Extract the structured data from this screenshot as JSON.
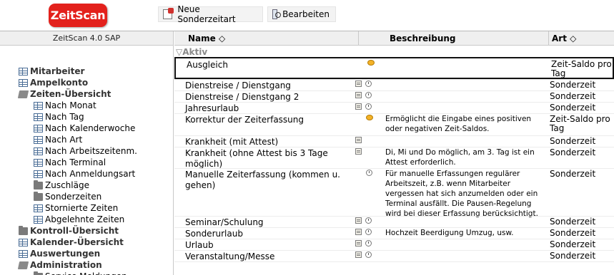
{
  "app": {
    "logo_text": "ZeitScan"
  },
  "toolbar": {
    "new_label": "Neue Sonderzeitart",
    "edit_label": "Bearbeiten"
  },
  "sidebar": {
    "title": "ZeitScan 4.0 SAP",
    "items": [
      {
        "label": "Mitarbeiter",
        "level": "top",
        "icon": "grid-icon"
      },
      {
        "label": "Ampelkonto",
        "level": "top",
        "icon": "grid-icon"
      },
      {
        "label": "Zeiten-Übersicht",
        "level": "top",
        "icon": "folder-open-icon"
      },
      {
        "label": "Nach Monat",
        "level": "child",
        "icon": "grid-icon"
      },
      {
        "label": "Nach Tag",
        "level": "child",
        "icon": "grid-icon"
      },
      {
        "label": "Nach Kalenderwoche",
        "level": "child",
        "icon": "grid-icon"
      },
      {
        "label": "Nach Art",
        "level": "child",
        "icon": "grid-icon"
      },
      {
        "label": "Nach Arbeitszeitenm.",
        "level": "child",
        "icon": "grid-icon"
      },
      {
        "label": "Nach Terminal",
        "level": "child",
        "icon": "grid-icon"
      },
      {
        "label": "Nach Anmeldungsart",
        "level": "child",
        "icon": "grid-icon"
      },
      {
        "label": "Zuschläge",
        "level": "child",
        "icon": "folder-icon"
      },
      {
        "label": "Sonderzeiten",
        "level": "child",
        "icon": "folder-icon"
      },
      {
        "label": "Stornierte Zeiten",
        "level": "child",
        "icon": "grid-icon"
      },
      {
        "label": "Abgelehnte Zeiten",
        "level": "child",
        "icon": "grid-icon"
      },
      {
        "label": "Kontroll-Übersicht",
        "level": "top",
        "icon": "folder-icon"
      },
      {
        "label": "Kalender-Übersicht",
        "level": "top",
        "icon": "grid-icon"
      },
      {
        "label": "Auswertungen",
        "level": "top",
        "icon": "grid-icon"
      },
      {
        "label": "Administration",
        "level": "top",
        "icon": "folder-open-icon"
      },
      {
        "label": "Service Meldungen",
        "level": "child",
        "icon": "folder-icon"
      }
    ]
  },
  "table": {
    "columns": {
      "name": "Name ◇",
      "beschreibung": "Beschreibung",
      "art": "Art ◇"
    },
    "group_label": "▽Aktiv",
    "rows": [
      {
        "name": "Ausgleich",
        "icons": [
          "coin-icon"
        ],
        "desc": "",
        "art": "Zeit-Saldo pro Tag",
        "selected": true
      },
      {
        "name": "Dienstreise / Dienstgang",
        "icons": [
          "calendar-icon",
          "clock-icon"
        ],
        "desc": "",
        "art": "Sonderzeit"
      },
      {
        "name": "Dienstreise / Dienstgang 2",
        "icons": [
          "calendar-icon",
          "clock-icon"
        ],
        "desc": "",
        "art": "Sonderzeit"
      },
      {
        "name": "Jahresurlaub",
        "icons": [
          "calendar-icon",
          "clock-icon"
        ],
        "desc": "",
        "art": "Sonderzeit"
      },
      {
        "name": "Korrektur der Zeiterfassung",
        "icons": [
          "coin-icon"
        ],
        "desc": "Ermöglicht die Eingabe eines positiven oder negativen Zeit-Saldos.",
        "art": "Zeit-Saldo pro Tag"
      },
      {
        "name": "Krankheit (mit Attest)",
        "icons": [
          "calendar-icon"
        ],
        "desc": "",
        "art": "Sonderzeit"
      },
      {
        "name": "Krankheit (ohne Attest bis 3 Tage möglich)",
        "icons": [
          "calendar-icon"
        ],
        "desc": "Di, Mi und Do möglich, am 3. Tag ist ein Attest erforderlich.",
        "art": "Sonderzeit"
      },
      {
        "name": "Manuelle Zeiterfassung (kommen u. gehen)",
        "icons": [
          "clock-icon"
        ],
        "desc": "Für manuelle Erfassungen regulärer Arbeitszeit, z.B. wenn Mitarbeiter vergessen hat sich anzumelden oder ein Terminal ausfällt. Die Pausen-Regelung wird bei dieser Erfassung berücksichtigt.",
        "art": "Sonderzeit"
      },
      {
        "name": "Seminar/Schulung",
        "icons": [
          "calendar-icon",
          "clock-icon"
        ],
        "desc": "",
        "art": "Sonderzeit"
      },
      {
        "name": "Sonderurlaub",
        "icons": [
          "calendar-icon",
          "clock-icon"
        ],
        "desc": "Hochzeit Beerdigung Umzug, usw.",
        "art": "Sonderzeit"
      },
      {
        "name": "Urlaub",
        "icons": [
          "calendar-icon",
          "clock-icon"
        ],
        "desc": "",
        "art": "Sonderzeit"
      },
      {
        "name": "Veranstaltung/Messe",
        "icons": [
          "calendar-icon",
          "clock-icon"
        ],
        "desc": "",
        "art": "Sonderzeit"
      }
    ]
  }
}
